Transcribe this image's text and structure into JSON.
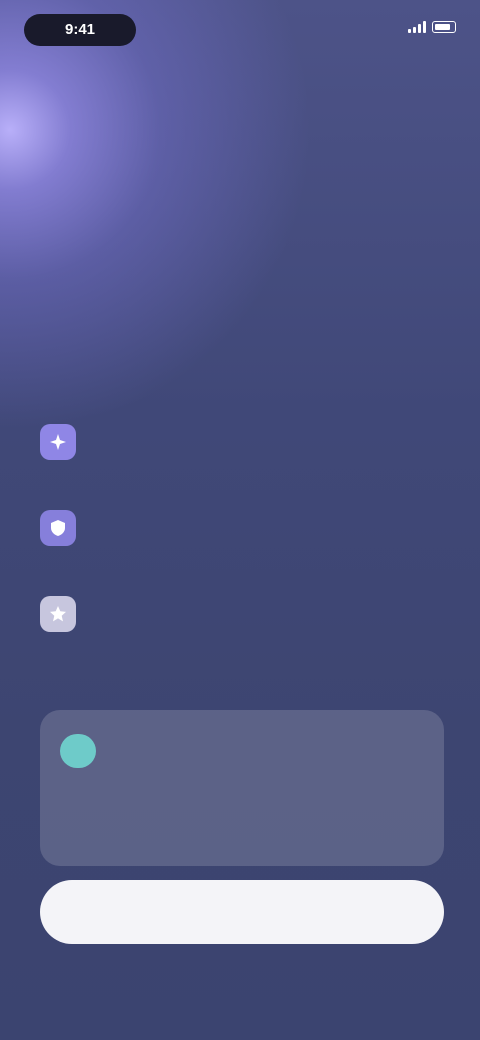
{
  "status_bar": {
    "time": "9:41"
  },
  "top_bar": {
    "title": "",
    "skip_label": ""
  },
  "headline": {
    "line1": "",
    "line2": "",
    "line3": ""
  },
  "subtitle": "",
  "features": [
    {
      "icon": "sparkle-icon",
      "title": "",
      "desc": ""
    },
    {
      "icon": "shield-icon",
      "title": "",
      "desc": ""
    },
    {
      "icon": "star-icon",
      "title": "",
      "desc": ""
    }
  ],
  "plan": {
    "badge": "",
    "name": "",
    "price": "",
    "note": ""
  },
  "cta_label": "",
  "footer": "",
  "colors": {
    "accent": "#b9b3ff",
    "badge": "#6ecbc9",
    "background": "#3e4673",
    "cta_background": "#f4f4f8"
  }
}
